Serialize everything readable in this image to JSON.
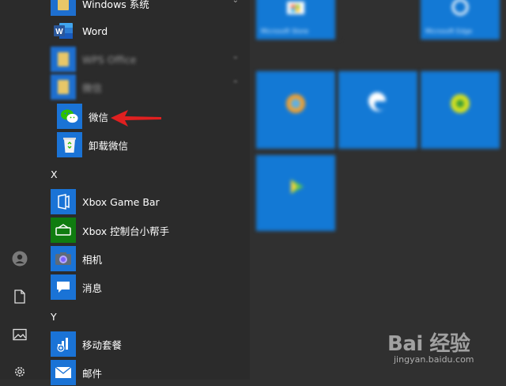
{
  "app_list": {
    "windows_system": "Windows 系统",
    "word": "Word",
    "wps_office": "WPS Office",
    "folder_blurred": "微信",
    "wechat": "微信",
    "uninstall_wechat": "卸载微信",
    "section_x": "X",
    "xbox_game_bar": "Xbox Game Bar",
    "xbox_console": "Xbox 控制台小帮手",
    "camera": "相机",
    "messaging": "消息",
    "section_y": "Y",
    "mobile_plans": "移动套餐",
    "mail": "邮件"
  },
  "tiles": {
    "tile_1": "Microsoft Store",
    "tile_2": "Microsoft Edge",
    "tile_3": "",
    "tile_4": "",
    "tile_5": "",
    "tile_6": ""
  },
  "watermark": {
    "logo": "Bai 经验",
    "url": "jingyan.baidu.com"
  },
  "colors": {
    "tile_blue": "#1379d5",
    "word_blue": "#2b579a",
    "xbox_green": "#107c10",
    "arrow_red": "#e02020",
    "wechat_green": "#2dc100"
  }
}
